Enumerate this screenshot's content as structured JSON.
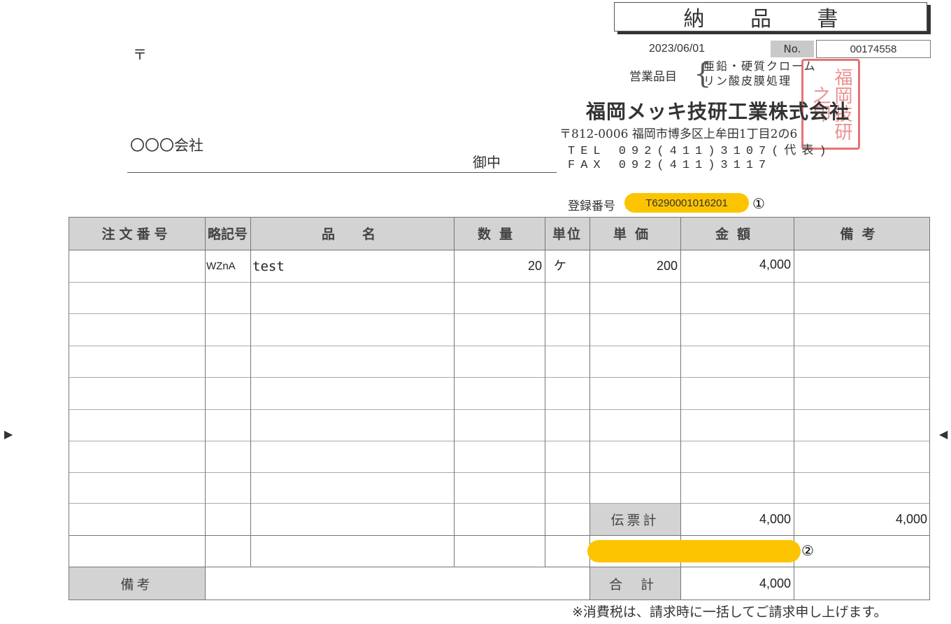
{
  "document": {
    "title": "納 品 書",
    "postal_mark": "〒",
    "date": "2023/06/01",
    "no_label": "No.",
    "no_value": "00174558",
    "customer_name": "〇〇〇会社",
    "customer_honorific": "御中",
    "registration_label": "登録番号",
    "registration_number": "T6290001016201",
    "marker_1": "①",
    "marker_2": "②",
    "footnote": "※消費税は、請求時に一括してご請求申し上げます。",
    "nav_left": "▶",
    "nav_right": "◀"
  },
  "supplier": {
    "items_label": "営業品目",
    "items_brace": "{",
    "items": [
      "亜鉛・硬質クローム",
      "リン酸皮膜処理"
    ],
    "company": "福岡メッキ技研工業株式会社",
    "address": "〒812-0006 福岡市博多区上牟田1丁目2の6",
    "tel": "TEL 092(411)3107(代表)",
    "fax": "FAX 092(411)3117",
    "seal_text": "福岡技研之印"
  },
  "table": {
    "headers": [
      "注文番号",
      "略記号",
      "品　名",
      "数量",
      "単位",
      "単価",
      "金額",
      "備考"
    ],
    "rows": [
      {
        "order_no": "",
        "code": "WZnA",
        "name": "test",
        "qty": "20",
        "unit": "ケ",
        "price": "200",
        "amount": "4,000",
        "note": ""
      }
    ],
    "slip_total_label": "伝票計",
    "slip_total_amount": "4,000",
    "slip_total_note": "4,000",
    "remarks_label": "備考",
    "grand_total_label": "合 計",
    "grand_total_amount": "4,000"
  }
}
